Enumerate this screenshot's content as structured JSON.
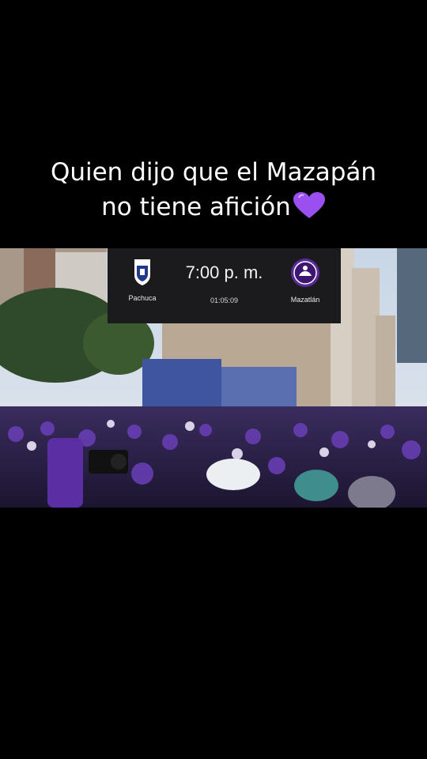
{
  "caption": {
    "line1": "Quien dijo que el Mazapán",
    "line2": "no tiene afición",
    "emoji": "purple-heart"
  },
  "scoreboard": {
    "home_team": "Pachuca",
    "away_team": "Mazatlán",
    "kickoff_time": "7:00 p. m.",
    "clock": "01:05:09"
  },
  "colors": {
    "background": "#000000",
    "accent_purple": "#7b3fd1",
    "scoreboard_bg": "#1b1b1d"
  }
}
